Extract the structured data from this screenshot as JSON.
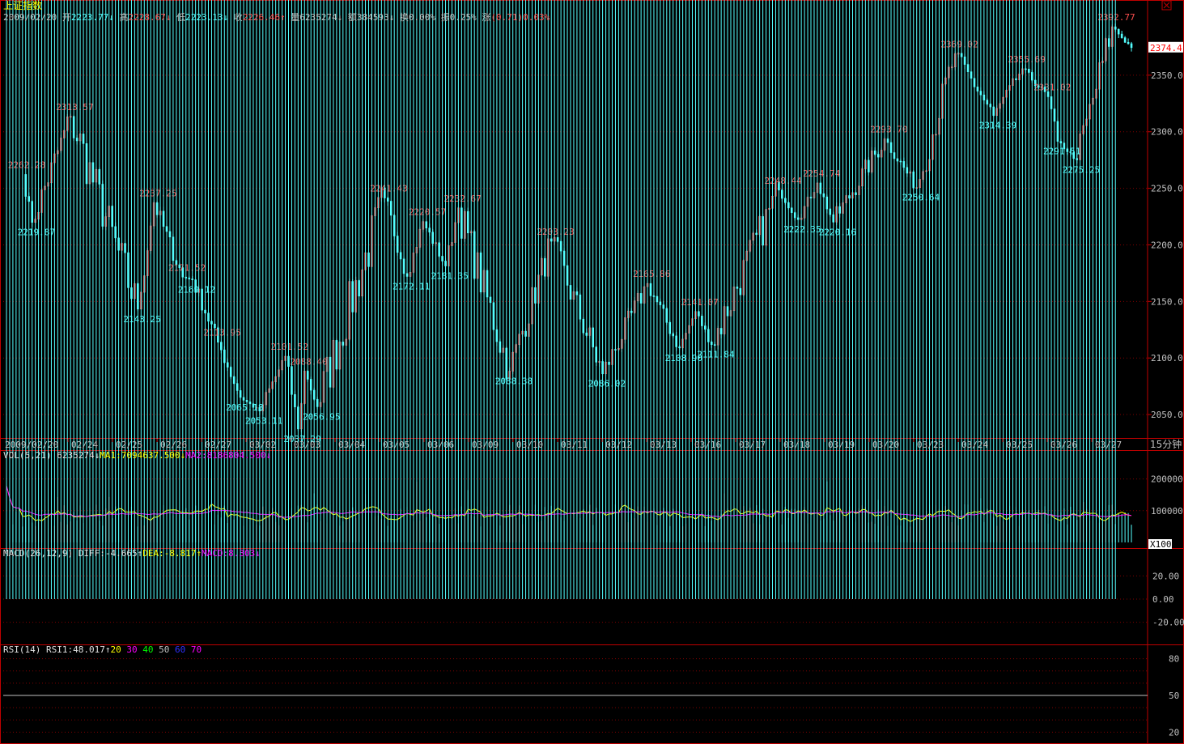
{
  "title": "上证指数",
  "header": {
    "date": "2009/02/20",
    "items": [
      {
        "label": "开",
        "value": "2223.77",
        "arrow": "↓",
        "color": "cyan"
      },
      {
        "label": "高",
        "value": "2228.67",
        "arrow": "↓",
        "color": "red"
      },
      {
        "label": "低",
        "value": "2223.13",
        "arrow": "↓",
        "color": "cyan"
      },
      {
        "label": "收",
        "value": "2226.46",
        "arrow": "↑",
        "color": "red"
      },
      {
        "label": "量",
        "value": "6235274",
        "arrow": "↓",
        "color": "gray"
      },
      {
        "label": "额",
        "value": "384593",
        "arrow": "↓",
        "color": "gray"
      },
      {
        "label": "换",
        "value": "0.00%",
        "arrow": "",
        "color": "gray"
      },
      {
        "label": "振",
        "value": "0.25%",
        "arrow": "",
        "color": "gray"
      },
      {
        "label": "涨",
        "value": "(0.71)0.03%",
        "arrow": "",
        "color": "red"
      }
    ],
    "close_icon": "close-icon"
  },
  "colors": {
    "up": "#ff5050",
    "down": "#54ffff",
    "grid": "#800000",
    "border": "#c00000",
    "ma1": "#ffff00",
    "ma2": "#ff00ff",
    "rsi": "#ffffff"
  },
  "price_axis": {
    "ticks": [
      "2350.0",
      "2300.0",
      "2250.0",
      "2200.0",
      "2150.0",
      "2100.0",
      "2050.0"
    ],
    "current": "2374.4"
  },
  "x_axis": {
    "labels": [
      "2009/02/20",
      "02/24",
      "02/25",
      "02/26",
      "02/27",
      "03/02",
      "03/03",
      "03/04",
      "03/05",
      "03/06",
      "03/09",
      "03/10",
      "03/11",
      "03/12",
      "03/13",
      "03/16",
      "03/17",
      "03/18",
      "03/19",
      "03/20",
      "03/23",
      "03/24",
      "03/25",
      "03/26",
      "03/27"
    ],
    "period": "15分钟"
  },
  "vol_header": {
    "name": "VOL(5,21)",
    "value": "6235274",
    "arrow": "↓",
    "ma1": "MA1:7094637.500",
    "ma1_arrow": "↓",
    "ma2": "MA2:8186804.500",
    "ma2_arrow": "↓"
  },
  "vol_axis": {
    "ticks": [
      "200000",
      "100000",
      "0"
    ],
    "unit": "X100"
  },
  "macd_header": {
    "name": "MACD(26,12,9)",
    "diff": "DIFF:-4.665",
    "diff_arrow": "↑",
    "dea": "DEA:-8.817",
    "dea_arrow": "↑",
    "macd": "MACD:8.303",
    "macd_arrow": "↓"
  },
  "macd_axis": {
    "ticks": [
      "20.00",
      "0.00",
      "-20.00"
    ]
  },
  "rsi_header": {
    "name": "RSI(14)",
    "rsi": "RSI1:48.017",
    "rsi_arrow": "↑",
    "levels": [
      "20",
      "30",
      "40",
      "50",
      "60",
      "70"
    ]
  },
  "rsi_axis": {
    "ticks": [
      "80",
      "50",
      "20"
    ]
  },
  "chart_data": {
    "type": "candlestick",
    "title": "上证指数",
    "period": "15分钟",
    "price_range": [
      2030,
      2395
    ],
    "pivots": [
      {
        "v": 2262.28,
        "t": "h",
        "lbl": "2262.28"
      },
      {
        "v": 2219.87,
        "t": "l",
        "lbl": "2219.87"
      },
      {
        "v": 2313.57,
        "t": "h",
        "lbl": "2313.57"
      },
      {
        "v": 2143.25,
        "t": "l",
        "lbl": "2143.25"
      },
      {
        "v": 2237.25,
        "t": "h",
        "lbl": "2237.25"
      },
      {
        "v": 2171.52,
        "t": "h",
        "lbl": "2171.52"
      },
      {
        "v": 2169.12,
        "t": "l",
        "lbl": "2169.12"
      },
      {
        "v": 2113.95,
        "t": "h",
        "lbl": "2113.95"
      },
      {
        "v": 2065.18,
        "t": "l",
        "lbl": "2065.18"
      },
      {
        "v": 2053.11,
        "t": "l",
        "lbl": "2053.11"
      },
      {
        "v": 2101.52,
        "t": "h",
        "lbl": "2101.52"
      },
      {
        "v": 2037.29,
        "t": "l",
        "lbl": "2037.29"
      },
      {
        "v": 2088.4,
        "t": "h",
        "lbl": "2088.40"
      },
      {
        "v": 2056.95,
        "t": "l",
        "lbl": "2056.95"
      },
      {
        "v": 2241.43,
        "t": "h",
        "lbl": "2241.43"
      },
      {
        "v": 2172.11,
        "t": "l",
        "lbl": "2172.11"
      },
      {
        "v": 2220.57,
        "t": "h",
        "lbl": "2220.57"
      },
      {
        "v": 2181.35,
        "t": "l",
        "lbl": "2181.35"
      },
      {
        "v": 2232.67,
        "t": "h",
        "lbl": "2232.67"
      },
      {
        "v": 2088.38,
        "t": "l",
        "lbl": "2088.38"
      },
      {
        "v": 2203.23,
        "t": "h",
        "lbl": "2203.23"
      },
      {
        "v": 2086.02,
        "t": "l",
        "lbl": "2086.02"
      },
      {
        "v": 2165.86,
        "t": "h",
        "lbl": "2165.86"
      },
      {
        "v": 2108.9,
        "t": "l",
        "lbl": "2108.90"
      },
      {
        "v": 2141.07,
        "t": "h",
        "lbl": "2141.07"
      },
      {
        "v": 2111.84,
        "t": "l",
        "lbl": "2111.84"
      },
      {
        "v": 2248.44,
        "t": "h",
        "lbl": "2248.44"
      },
      {
        "v": 2222.35,
        "t": "l",
        "lbl": "2222.35"
      },
      {
        "v": 2254.74,
        "t": "h",
        "lbl": "2254.74"
      },
      {
        "v": 2220.16,
        "t": "l",
        "lbl": "2220.16"
      },
      {
        "v": 2293.7,
        "t": "h",
        "lbl": "2293.70"
      },
      {
        "v": 2250.64,
        "t": "l",
        "lbl": "2250.64"
      },
      {
        "v": 2369.02,
        "t": "h",
        "lbl": "2369.02"
      },
      {
        "v": 2314.39,
        "t": "l",
        "lbl": "2314.39"
      },
      {
        "v": 2355.69,
        "t": "h",
        "lbl": "2355.69"
      },
      {
        "v": 2331.02,
        "t": "h",
        "lbl": "2331.02"
      },
      {
        "v": 2291.51,
        "t": "l",
        "lbl": "2291.51"
      },
      {
        "v": 2275.25,
        "t": "l",
        "lbl": "2275.25"
      },
      {
        "v": 2392.77,
        "t": "h",
        "lbl": "2392.77"
      },
      {
        "v": 2374.4,
        "t": "c",
        "lbl": ""
      }
    ],
    "volume_range": [
      0,
      250000
    ],
    "macd_range": [
      -35,
      35
    ],
    "rsi_range": [
      15,
      85
    ]
  }
}
